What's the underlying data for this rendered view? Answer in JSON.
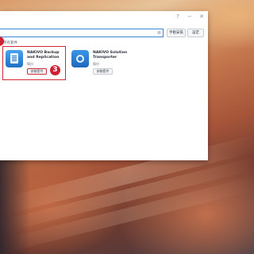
{
  "window": {
    "controls": {
      "help": "?",
      "minimize": "−",
      "close": "✕"
    }
  },
  "toolbar": {
    "search": {
      "clear": "⊗"
    },
    "manual_install_label": "手動安裝",
    "settings_label": "設定"
  },
  "section_label": "所有套件",
  "packages": [
    {
      "name": "NAKIVO Backup and Replication",
      "category": "備份",
      "install_label": "安裝套件",
      "icon": "document-list-icon"
    },
    {
      "name": "NAKIVO Solution Transporter",
      "category": "備份",
      "install_label": "安裝套件",
      "icon": "gear-icon"
    }
  ],
  "annotations": {
    "step_three": "3"
  }
}
